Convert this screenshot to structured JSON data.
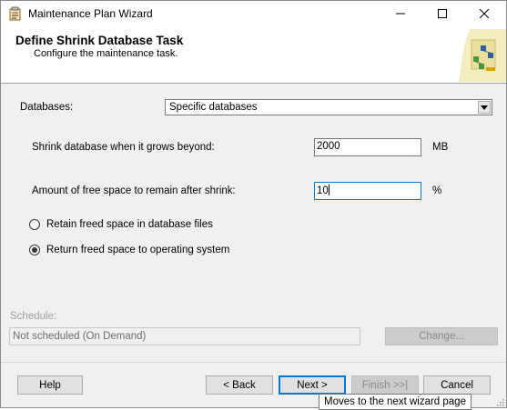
{
  "window": {
    "title": "Maintenance Plan Wizard"
  },
  "header": {
    "title": "Define Shrink Database Task",
    "subtitle": "Configure the maintenance task."
  },
  "form": {
    "databases_label": "Databases:",
    "databases_value": "Specific databases",
    "shrink_label": "Shrink database when it grows beyond:",
    "shrink_value": "2000",
    "shrink_unit": "MB",
    "free_space_label": "Amount of free space to remain after shrink:",
    "free_space_value": "10",
    "free_space_unit": "%",
    "radio_retain": {
      "label": "Retain freed space in database files",
      "checked": false
    },
    "radio_return": {
      "label": "Return freed space to operating system",
      "checked": true
    }
  },
  "schedule": {
    "label": "Schedule:",
    "value": "Not scheduled (On Demand)",
    "change_label": "Change..."
  },
  "buttons": {
    "help": "Help",
    "back": "< Back",
    "next": "Next >",
    "finish": "Finish >>|",
    "cancel": "Cancel"
  },
  "tooltip": "Moves to the next wizard page",
  "colors": {
    "focus_border": "#0078d7",
    "disabled_text": "#a0a0a0"
  }
}
